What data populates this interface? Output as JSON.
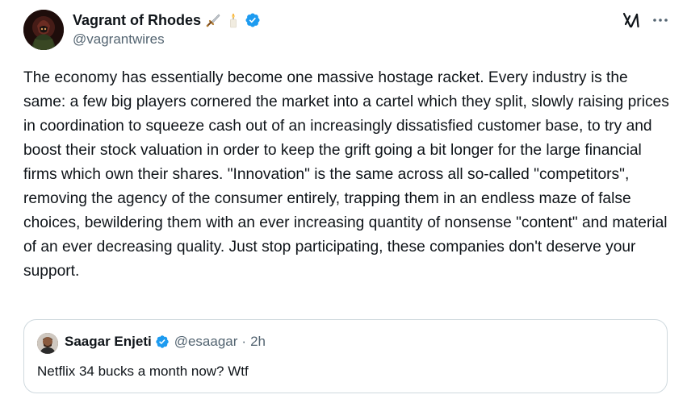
{
  "author": {
    "display_name": "Vagrant of Rhodes",
    "handle": "@vagrantwires",
    "name_emojis": [
      "dagger-icon",
      "candle-icon"
    ],
    "verified": true
  },
  "actions": {
    "grok_icon": "grok-icon",
    "more_icon": "more-horizontal-icon"
  },
  "tweet": {
    "text": "The economy has essentially become one massive hostage racket. Every industry is the same: a few big players cornered the market into a cartel which they split, slowly raising prices in coordination to squeeze cash out of an increasingly dissatisfied customer base, to try and boost their stock valuation in order to keep the grift going a bit longer for the large financial firms which own their shares. \"Innovation\" is the same across all so-called \"competitors\", removing the agency of the consumer entirely, trapping them in an endless maze of false choices, bewildering them with an ever increasing quantity of nonsense \"content\" and material of an ever decreasing quality. Just stop participating, these companies don't deserve your support."
  },
  "quote": {
    "display_name": "Saagar Enjeti",
    "handle": "@esaagar",
    "separator": "·",
    "time": "2h",
    "verified": true,
    "text": "Netflix 34 bucks a month now? Wtf"
  },
  "colors": {
    "text_primary": "#0f1419",
    "text_secondary": "#536471",
    "verified_blue": "#1d9bf0",
    "border": "#cfd9de"
  }
}
